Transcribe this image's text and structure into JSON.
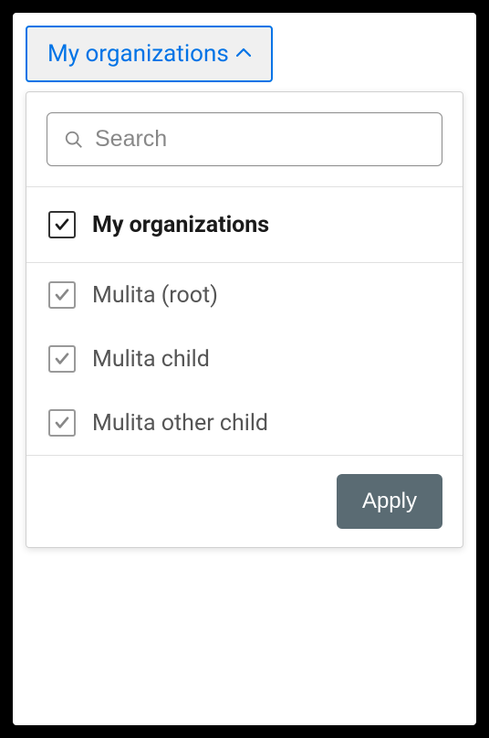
{
  "dropdown": {
    "trigger_label": "My organizations",
    "search_placeholder": "Search",
    "apply_label": "Apply",
    "options": [
      {
        "label": "My organizations",
        "checked": true,
        "bold": true
      },
      {
        "label": "Mulita (root)",
        "checked": true,
        "bold": false
      },
      {
        "label": "Mulita child",
        "checked": true,
        "bold": false
      },
      {
        "label": "Mulita other child",
        "checked": true,
        "bold": false
      }
    ]
  },
  "colors": {
    "accent": "#0073e6",
    "apply_bg": "#5a6b73"
  }
}
